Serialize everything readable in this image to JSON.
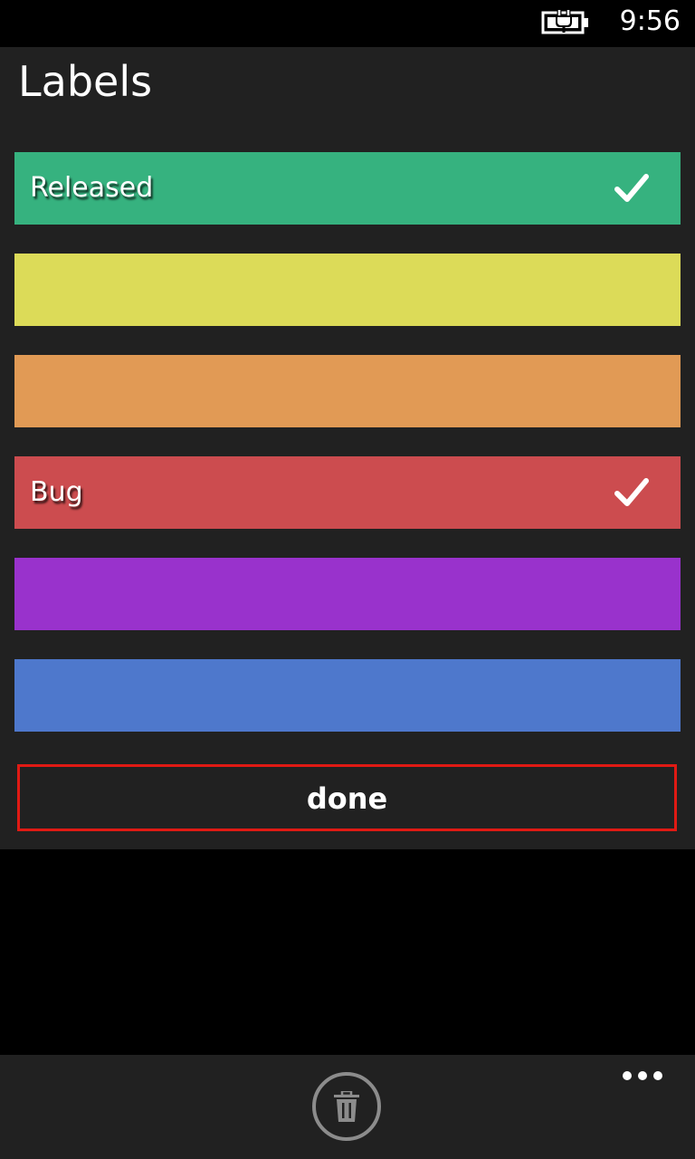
{
  "status_bar": {
    "time": "9:56",
    "battery_icon": "battery-charging-icon"
  },
  "dialog": {
    "title": "Labels",
    "labels": [
      {
        "text": "Released",
        "color": "#36b27f",
        "checked": true
      },
      {
        "text": "",
        "color": "#dcdb58",
        "checked": false
      },
      {
        "text": "",
        "color": "#e19a55",
        "checked": false
      },
      {
        "text": "Bug",
        "color": "#cc4c4f",
        "checked": true
      },
      {
        "text": "",
        "color": "#9932cc",
        "checked": false
      },
      {
        "text": "",
        "color": "#4e78cc",
        "checked": false
      }
    ],
    "done_label": "done",
    "done_border_color": "#e01a14"
  },
  "app_bar": {
    "delete_icon": "trash-icon",
    "more_icon": "ellipsis-icon"
  },
  "colors": {
    "panel_background": "#212121",
    "screen_background": "#000000",
    "app_bar_background": "#212121"
  }
}
